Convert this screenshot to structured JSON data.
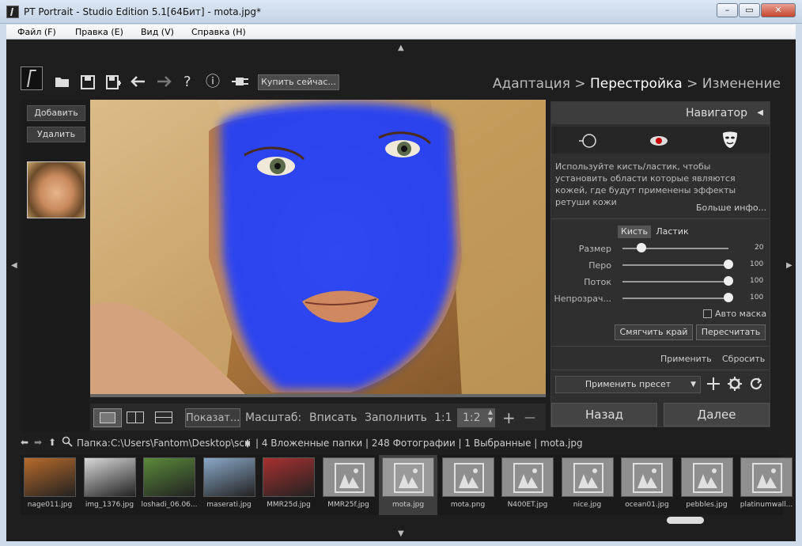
{
  "window": {
    "title": "PT Portrait - Studio Edition 5.1[64Бит] - mota.jpg*",
    "min": "–",
    "max": "▭",
    "close": "✕"
  },
  "menu": [
    "Файл (F)",
    "Правка (E)",
    "Вид (V)",
    "Справка (H)"
  ],
  "toolbar": {
    "buy_label": "Купить сейчас...",
    "help": "?",
    "info": "ⓘ"
  },
  "breadcrumb": {
    "step1": "Адаптация",
    "sep": " > ",
    "step2": "Перестройка",
    "step3": "Изменение"
  },
  "left": {
    "add_label": "Добавить",
    "delete_label": "Удалить"
  },
  "right": {
    "navigator": "Навигатор",
    "description": "Используйте кисть/ластик, чтобы установить области  которые являются кожей, где будут применены эффекты ретуши кожи",
    "more_info": "Больше инфо...",
    "tab_brush": "Кисть",
    "tab_eraser": "Ластик",
    "sliders": [
      {
        "label": "Размер",
        "value": "20",
        "level": 0.18
      },
      {
        "label": "Перо",
        "value": "100",
        "level": 1.0
      },
      {
        "label": "Поток",
        "value": "100",
        "level": 1.0
      },
      {
        "label": "Непрозрач...",
        "value": "100",
        "level": 1.0
      }
    ],
    "auto_mask": "Авто маска",
    "smooth_edge": "Смягчить край",
    "recalc": "Пересчитать",
    "apply": "Применить",
    "reset": "Сбросить",
    "preset": "Применить пресет",
    "back": "Назад",
    "next": "Далее"
  },
  "viewbar": {
    "show": "Показат...",
    "zoom": "Масштаб:",
    "fit": "Вписать",
    "fill": "Заполнить",
    "one_one": "1:1",
    "one_two": "1:2",
    "plus": "+",
    "minus": "—"
  },
  "pathbar": {
    "label": "Папка:",
    "path": "C:\\Users\\Fantom\\Desktop\\scrin",
    "info": "| 4 Вложенные папки | 248 Фотографии | 1 Выбранные | mota.jpg"
  },
  "filmstrip": [
    {
      "name": "nage011.jpg",
      "kind": "photo",
      "color": "#b86a2a"
    },
    {
      "name": "img_1376.jpg",
      "kind": "photo",
      "color": "#d8d8d8"
    },
    {
      "name": "loshadi_06.06...",
      "kind": "photo",
      "color": "#5a8a3a"
    },
    {
      "name": "maserati.jpg",
      "kind": "photo",
      "color": "#8aa8c8"
    },
    {
      "name": "MMR25d.jpg",
      "kind": "photo",
      "color": "#a83030"
    },
    {
      "name": "MMR25f.jpg",
      "kind": "placeholder"
    },
    {
      "name": "mota.jpg",
      "kind": "placeholder",
      "selected": true
    },
    {
      "name": "mota.png",
      "kind": "placeholder"
    },
    {
      "name": "N400ET.jpg",
      "kind": "placeholder"
    },
    {
      "name": "nice.jpg",
      "kind": "placeholder"
    },
    {
      "name": "ocean01.jpg",
      "kind": "placeholder"
    },
    {
      "name": "pebbles.jpg",
      "kind": "placeholder"
    },
    {
      "name": "platinumwall...",
      "kind": "placeholder"
    }
  ],
  "colors": {
    "mask": "#1a3dff",
    "accent": "#ffffff"
  }
}
